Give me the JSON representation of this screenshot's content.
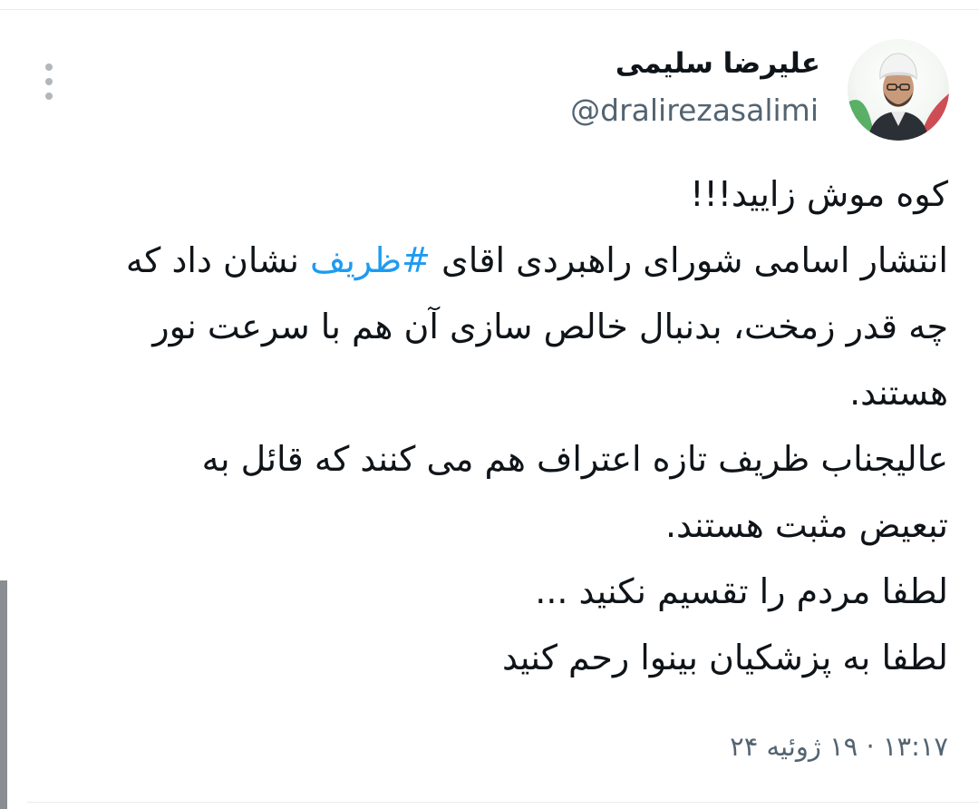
{
  "tweet": {
    "author_name": "علیرضا سلیمی",
    "author_handle": "@dralirezasalimi",
    "avatar_icon": "person-portrait-icon",
    "more_icon": "vertical-ellipsis-icon",
    "lines": [
      {
        "text": "کوه موش زایید!!!"
      },
      {
        "before": "انتشار اسامی شورای راهبردی اقای ",
        "hashtag": "#ظریف",
        "after": " نشان داد که"
      },
      {
        "text": "چه قدر زمخت، بدنبال خالص سازی آن هم با سرعت نور"
      },
      {
        "text": "هستند."
      },
      {
        "text": "عالیجناب ظریف تازه اعتراف هم می کنند که قائل به"
      },
      {
        "text": "تبعیض مثبت هستند."
      },
      {
        "text": "لطفا مردم را تقسیم نکنید ..."
      },
      {
        "text": "لطفا به پزشکیان بینوا رحم کنید"
      }
    ],
    "timestamp": "۱۳:۱۷ · ۱۹ ژوئیه ۲۴",
    "hashtag_color": "#1d9bf0"
  }
}
